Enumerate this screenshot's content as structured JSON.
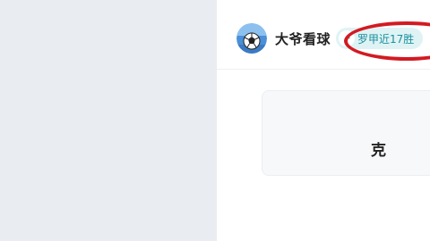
{
  "author": {
    "name": "大爷看球",
    "avatar_icon": "soccer-ball-avatar"
  },
  "badge": {
    "icon": "trend-icon",
    "text": "罗甲近17胜"
  },
  "card": {
    "text": "克"
  },
  "colors": {
    "left_panel_bg": "#e9ecf0",
    "badge_bg": "#dff3f5",
    "badge_text": "#1a8f9c",
    "annotation_red": "#d31a22",
    "card_bg": "#f7f8fa"
  }
}
